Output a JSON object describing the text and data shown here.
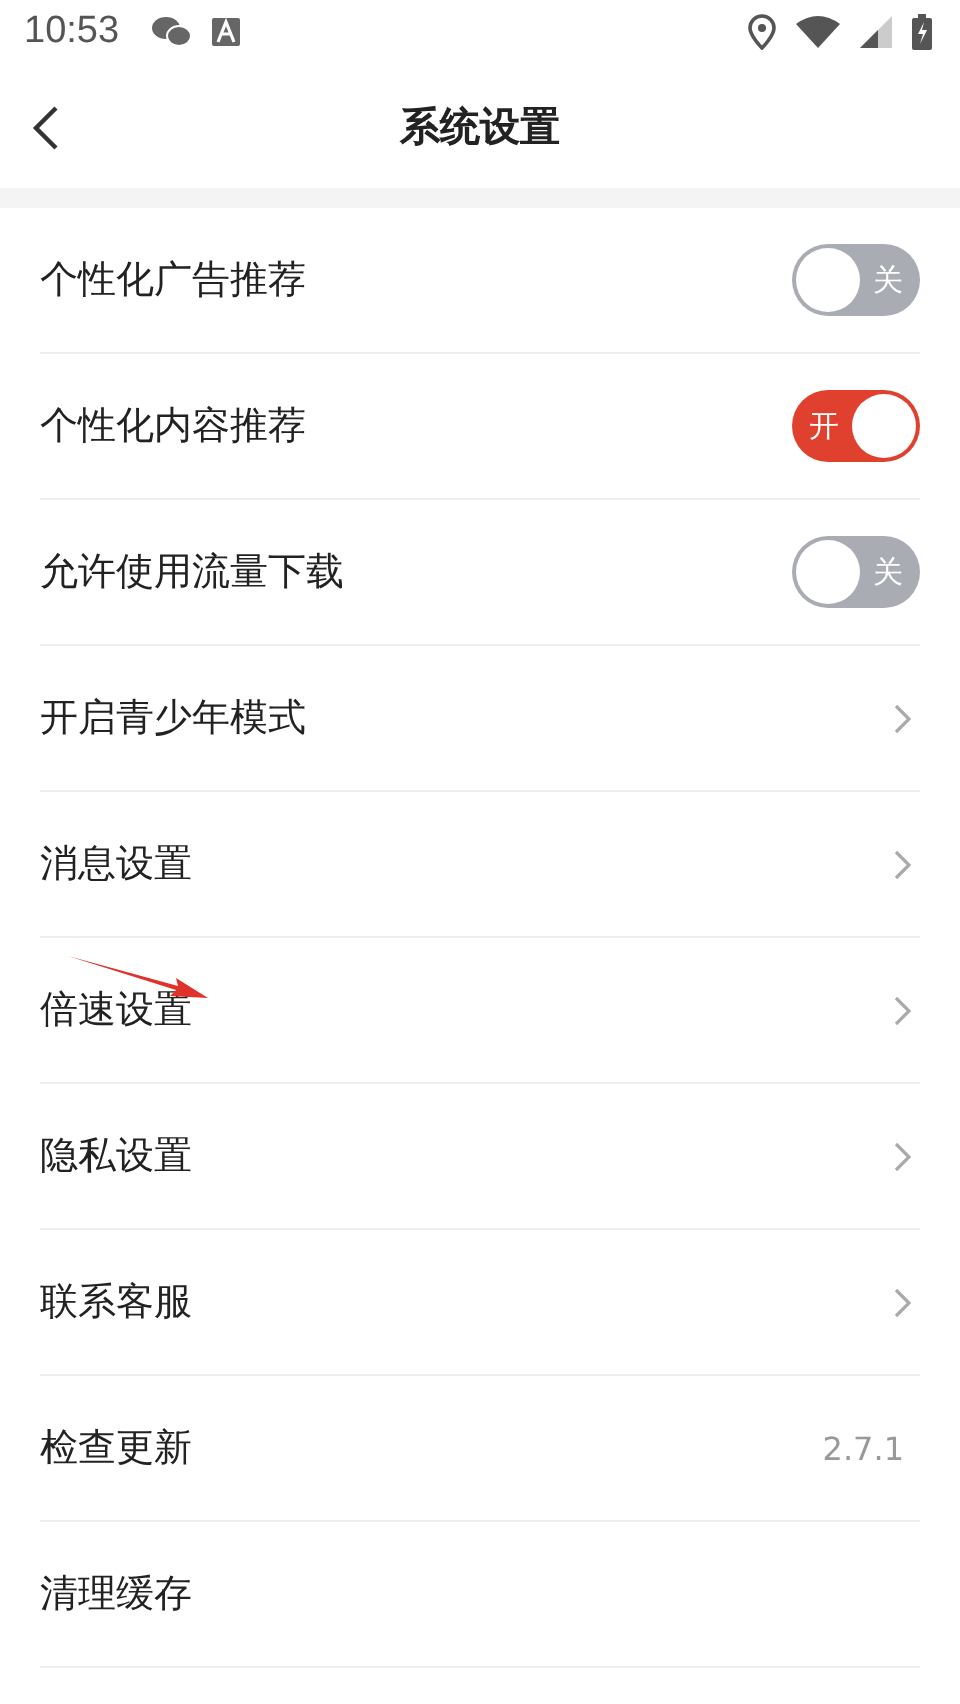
{
  "status_bar": {
    "time": "10:53"
  },
  "header": {
    "title": "系统设置"
  },
  "settings": [
    {
      "kind": "toggle",
      "label": "个性化广告推荐",
      "on": false,
      "switch_text": "关"
    },
    {
      "kind": "toggle",
      "label": "个性化内容推荐",
      "on": true,
      "switch_text": "开"
    },
    {
      "kind": "toggle",
      "label": "允许使用流量下载",
      "on": false,
      "switch_text": "关"
    },
    {
      "kind": "link",
      "label": "开启青少年模式"
    },
    {
      "kind": "link",
      "label": "消息设置"
    },
    {
      "kind": "link",
      "label": "倍速设置",
      "annotated": true
    },
    {
      "kind": "link",
      "label": "隐私设置"
    },
    {
      "kind": "link",
      "label": "联系客服"
    },
    {
      "kind": "value",
      "label": "检查更新",
      "value": "2.7.1"
    },
    {
      "kind": "value",
      "label": "清理缓存"
    }
  ]
}
